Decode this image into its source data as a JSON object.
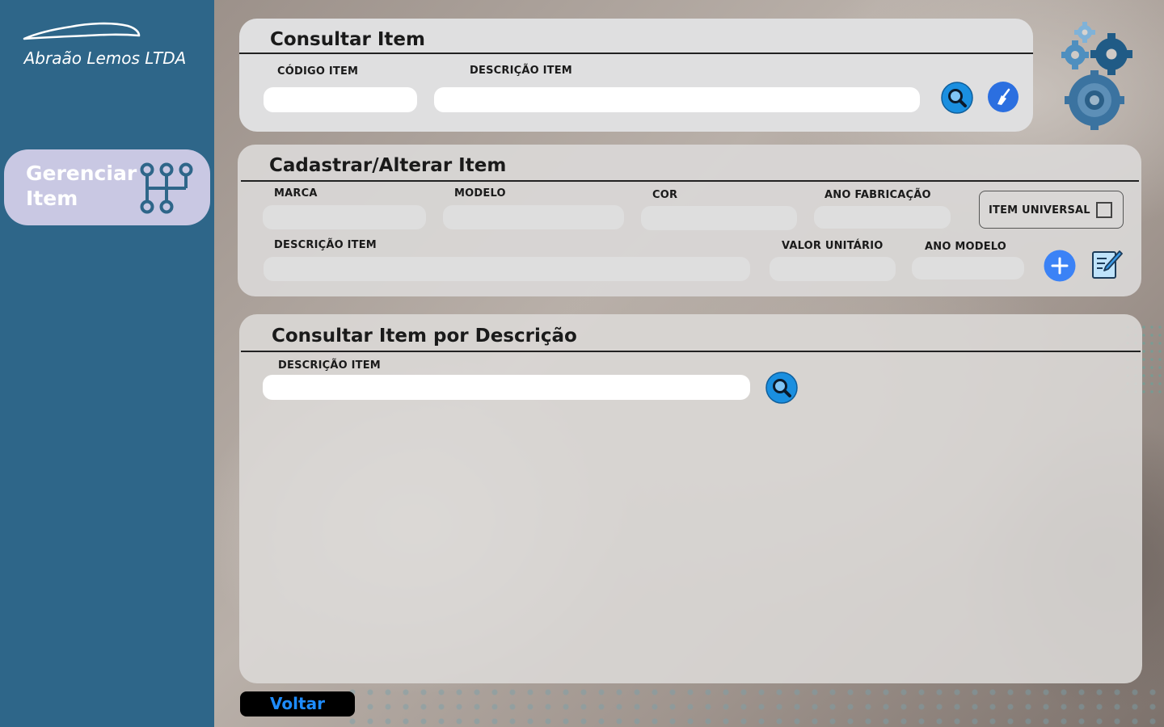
{
  "sidebar": {
    "brand": "Abraão Lemos LTDA",
    "nav": {
      "label": "Gerenciar Item"
    }
  },
  "consultar": {
    "title": "Consultar Item",
    "codigo_label": "CÓDIGO ITEM",
    "codigo_value": "",
    "descricao_label": "DESCRIÇÃO ITEM",
    "descricao_value": ""
  },
  "cadastrar": {
    "title": "Cadastrar/Alterar Item",
    "marca_label": "MARCA",
    "modelo_label": "MODELO",
    "cor_label": "COR",
    "ano_fabricacao_label": "ANO FABRICAÇÃO",
    "item_universal_label": "ITEM UNIVERSAL",
    "item_universal_checked": false,
    "descricao_label": "DESCRIÇÃO ITEM",
    "valor_unitario_label": "VALOR UNITÁRIO",
    "ano_modelo_label": "ANO MODELO"
  },
  "consultar_descricao": {
    "title": "Consultar Item por Descrição",
    "descricao_label": "DESCRIÇÃO ITEM",
    "descricao_value": ""
  },
  "footer": {
    "back_label": "Voltar"
  },
  "colors": {
    "sidebar": "#2e6689",
    "nav_card": "#c9c8e3",
    "button_blue": "#1a8fe0",
    "add_blue": "#3b82f6",
    "back_text": "#1e8cff"
  },
  "icons": {
    "search": "search-icon",
    "clear": "broom-icon",
    "add": "plus-icon",
    "edit": "edit-icon",
    "gears": "gears-icon",
    "gearshift": "gearshift-icon",
    "car": "car-logo-icon"
  }
}
